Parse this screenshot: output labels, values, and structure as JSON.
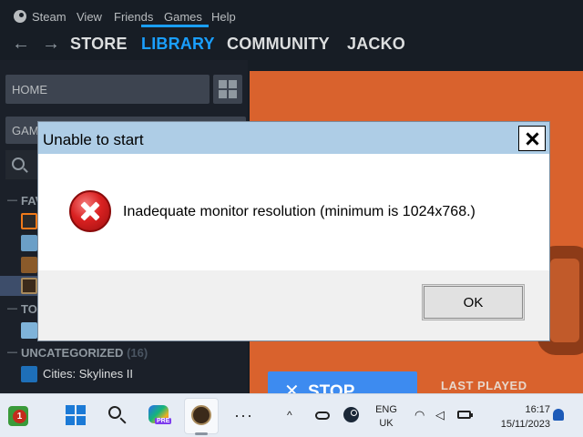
{
  "steam_menu": {
    "items": [
      "Steam",
      "View",
      "Friends",
      "Games",
      "Help"
    ]
  },
  "steam_nav": {
    "store": "STORE",
    "library": "LIBRARY",
    "community": "COMMUNITY",
    "user": "JACKO",
    "back": "←",
    "forward": "→"
  },
  "library": {
    "home_label": "HOME",
    "games_label": "GAM",
    "sections": {
      "favorites": "FAV",
      "top": "TO",
      "uncategorized": "UNCATEGORIZED",
      "uncategorized_count": "(16)"
    },
    "games": [
      {
        "label": "Cities: Skylines II"
      }
    ]
  },
  "game_area": {
    "stop_label": "STOP",
    "stop_icon": "✕",
    "last_played_label": "LAST PLAYED"
  },
  "dialog": {
    "title": "Unable to start",
    "message": "Inadequate monitor resolution (minimum is 1024x768.)",
    "ok_label": "OK"
  },
  "taskbar": {
    "notification_badge": "1",
    "copilot_badge": "PRE",
    "more_label": "···",
    "tray_chevron": "^",
    "language_line1": "ENG",
    "language_line2": "UK",
    "time": "16:17",
    "date": "15/11/2023"
  },
  "colors": {
    "steam_bg": "#171d25",
    "steam_accent": "#1a9fff",
    "hero_orange": "#d9622d",
    "stop_blue": "#3d8bf0",
    "dialog_title_bar": "#aecde6",
    "error_red": "#d92121"
  }
}
